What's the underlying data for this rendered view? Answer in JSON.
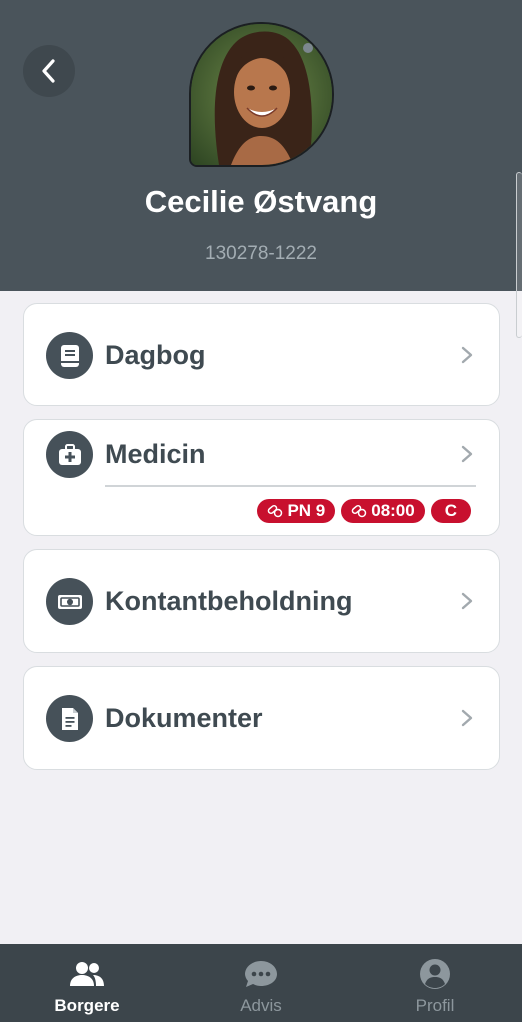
{
  "header": {
    "name": "Cecilie Østvang",
    "cpr": "130278-1222",
    "back_icon": "chevron-left-icon",
    "avatar": "profile-photo"
  },
  "menu": {
    "dagbog": {
      "label": "Dagbog",
      "icon": "journal-icon"
    },
    "medicin": {
      "label": "Medicin",
      "icon": "medkit-icon",
      "badges": [
        {
          "icon": "pill-icon",
          "text": "PN 9"
        },
        {
          "icon": "pill-icon",
          "text": "08:00"
        },
        {
          "text": "C"
        }
      ]
    },
    "kontant": {
      "label": "Kontantbeholdning",
      "icon": "cash-icon"
    },
    "dokumenter": {
      "label": "Dokumenter",
      "icon": "document-icon"
    }
  },
  "tabbar": {
    "tabs": [
      {
        "label": "Borgere",
        "icon": "people-icon",
        "active": true
      },
      {
        "label": "Advis",
        "icon": "chat-icon",
        "active": false
      },
      {
        "label": "Profil",
        "icon": "user-circle-icon",
        "active": false
      }
    ]
  },
  "colors": {
    "header_bg": "#4a545b",
    "page_bg": "#f1f0f4",
    "badge_red": "#c8102e",
    "tabbar_bg": "#3c454b",
    "icon_circle": "#465159"
  }
}
